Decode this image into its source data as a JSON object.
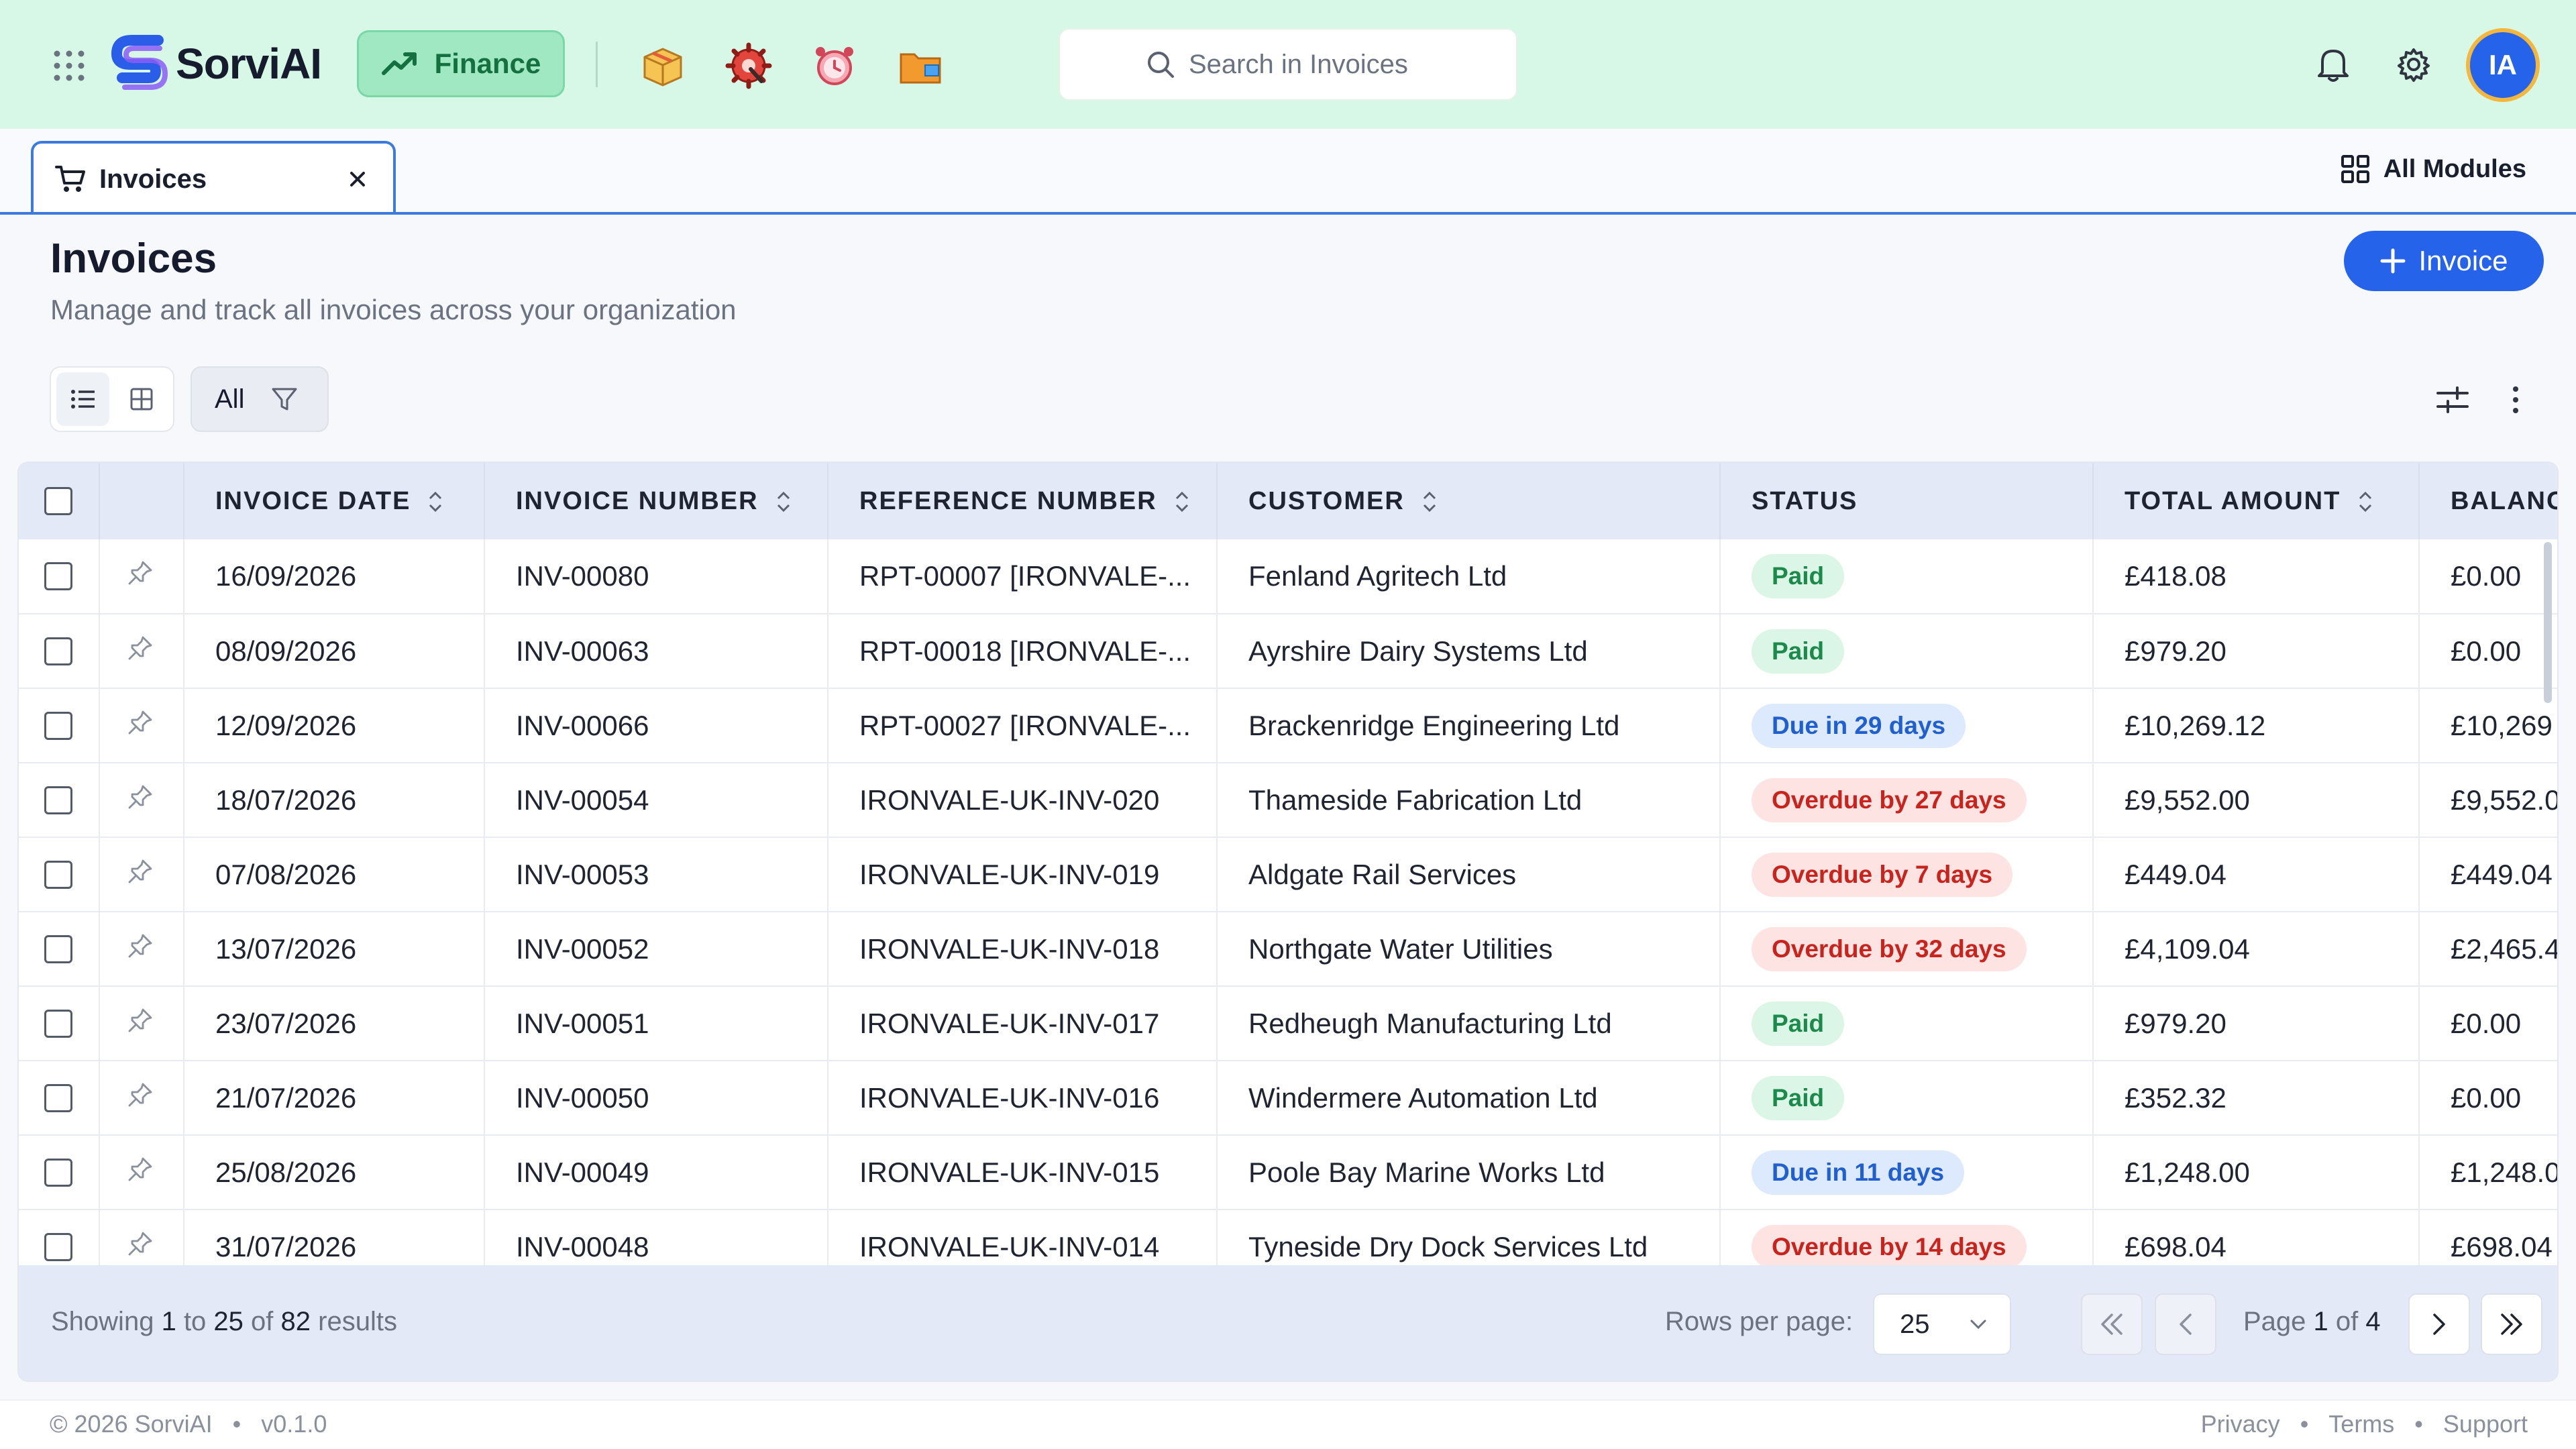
{
  "app": {
    "brand": "SorviAI",
    "module": "Finance",
    "search_placeholder": "Search in Invoices",
    "avatar_initials": "IA",
    "accent": "#2663eb",
    "topbar_bg": "#d7f8e6"
  },
  "tabs": [
    {
      "label": "Invoices",
      "icon": "cart-icon",
      "active": true
    }
  ],
  "all_modules_label": "All Modules",
  "page": {
    "title": "Invoices",
    "subtitle": "Manage and track all invoices across your organization",
    "add_button": "Invoice"
  },
  "toolbar": {
    "filter_label": "All"
  },
  "table": {
    "columns": [
      "INVOICE DATE",
      "INVOICE NUMBER",
      "REFERENCE NUMBER",
      "CUSTOMER",
      "STATUS",
      "TOTAL AMOUNT",
      "BALANCE"
    ],
    "rows": [
      {
        "date": "16/09/2026",
        "number": "INV-00080",
        "reference": "RPT-00007 [IRONVALE-...",
        "customer": "Fenland Agritech Ltd",
        "status": "Paid",
        "status_type": "paid",
        "total": "£418.08",
        "balance": "£0.00"
      },
      {
        "date": "08/09/2026",
        "number": "INV-00063",
        "reference": "RPT-00018 [IRONVALE-...",
        "customer": "Ayrshire Dairy Systems Ltd",
        "status": "Paid",
        "status_type": "paid",
        "total": "£979.20",
        "balance": "£0.00"
      },
      {
        "date": "12/09/2026",
        "number": "INV-00066",
        "reference": "RPT-00027 [IRONVALE-...",
        "customer": "Brackenridge Engineering Ltd",
        "status": "Due in 29 days",
        "status_type": "due",
        "total": "£10,269.12",
        "balance": "£10,269"
      },
      {
        "date": "18/07/2026",
        "number": "INV-00054",
        "reference": "IRONVALE-UK-INV-020",
        "customer": "Thameside Fabrication Ltd",
        "status": "Overdue by 27 days",
        "status_type": "overdue",
        "total": "£9,552.00",
        "balance": "£9,552.0"
      },
      {
        "date": "07/08/2026",
        "number": "INV-00053",
        "reference": "IRONVALE-UK-INV-019",
        "customer": "Aldgate Rail Services",
        "status": "Overdue by 7 days",
        "status_type": "overdue",
        "total": "£449.04",
        "balance": "£449.04"
      },
      {
        "date": "13/07/2026",
        "number": "INV-00052",
        "reference": "IRONVALE-UK-INV-018",
        "customer": "Northgate Water Utilities",
        "status": "Overdue by 32 days",
        "status_type": "overdue",
        "total": "£4,109.04",
        "balance": "£2,465.4"
      },
      {
        "date": "23/07/2026",
        "number": "INV-00051",
        "reference": "IRONVALE-UK-INV-017",
        "customer": "Redheugh Manufacturing Ltd",
        "status": "Paid",
        "status_type": "paid",
        "total": "£979.20",
        "balance": "£0.00"
      },
      {
        "date": "21/07/2026",
        "number": "INV-00050",
        "reference": "IRONVALE-UK-INV-016",
        "customer": "Windermere Automation Ltd",
        "status": "Paid",
        "status_type": "paid",
        "total": "£352.32",
        "balance": "£0.00"
      },
      {
        "date": "25/08/2026",
        "number": "INV-00049",
        "reference": "IRONVALE-UK-INV-015",
        "customer": "Poole Bay Marine Works Ltd",
        "status": "Due in 11 days",
        "status_type": "due",
        "total": "£1,248.00",
        "balance": "£1,248.0"
      },
      {
        "date": "31/07/2026",
        "number": "INV-00048",
        "reference": "IRONVALE-UK-INV-014",
        "customer": "Tyneside Dry Dock Services Ltd",
        "status": "Overdue by 14 days",
        "status_type": "overdue",
        "total": "£698.04",
        "balance": "£698.04"
      }
    ]
  },
  "pagination": {
    "showing_prefix": "Showing",
    "from": "1",
    "to_word": "to",
    "to": "25",
    "of_word": "of",
    "total": "82",
    "results_word": "results",
    "rows_per_page_label": "Rows per page:",
    "rows_per_page": "25",
    "page_word": "Page",
    "page": "1",
    "page_of_word": "of",
    "page_count": "4"
  },
  "footer": {
    "copyright": "© 2026 SorviAI",
    "version": "v0.1.0",
    "links": [
      "Privacy",
      "Terms",
      "Support"
    ]
  },
  "status_colors": {
    "paid": "#1b8a4a",
    "due": "#1f5fd0",
    "overdue": "#c8231d"
  }
}
